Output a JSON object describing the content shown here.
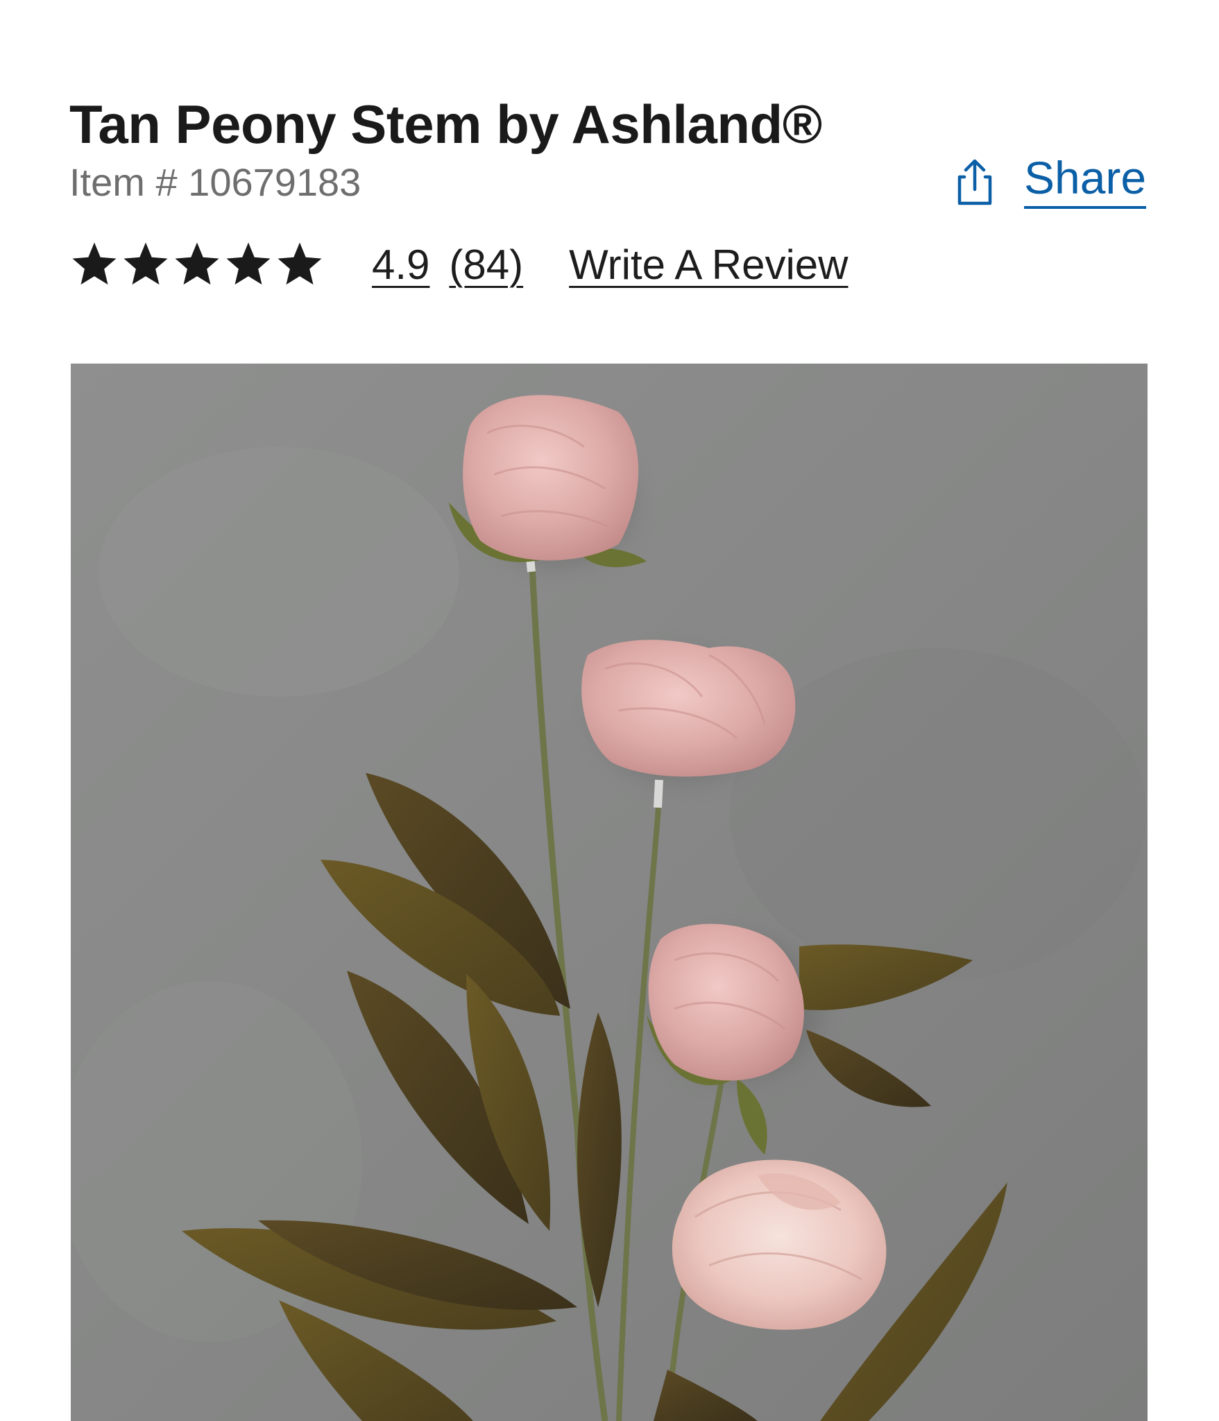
{
  "product": {
    "title": "Tan Peony Stem by Ashland®",
    "item_number": "Item # 10679183",
    "share_label": "Share",
    "share_icon": "share-icon",
    "rating": {
      "stars": 5,
      "star_icon": "star-icon",
      "value": "4.9",
      "count": "(84)",
      "write_review_label": "Write A Review"
    },
    "colors": {
      "link_blue": "#0b5fa6",
      "title": "#1a1a1a",
      "muted": "#6e6e6e"
    }
  }
}
